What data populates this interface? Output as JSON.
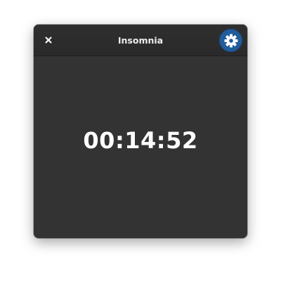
{
  "window": {
    "title": "Insomnia",
    "accent_color": "#215d9c",
    "background_color": "#333333"
  },
  "headerbar": {
    "close_icon": "close-icon",
    "settings_icon": "gear-icon"
  },
  "timer": {
    "display": "00:14:52"
  }
}
